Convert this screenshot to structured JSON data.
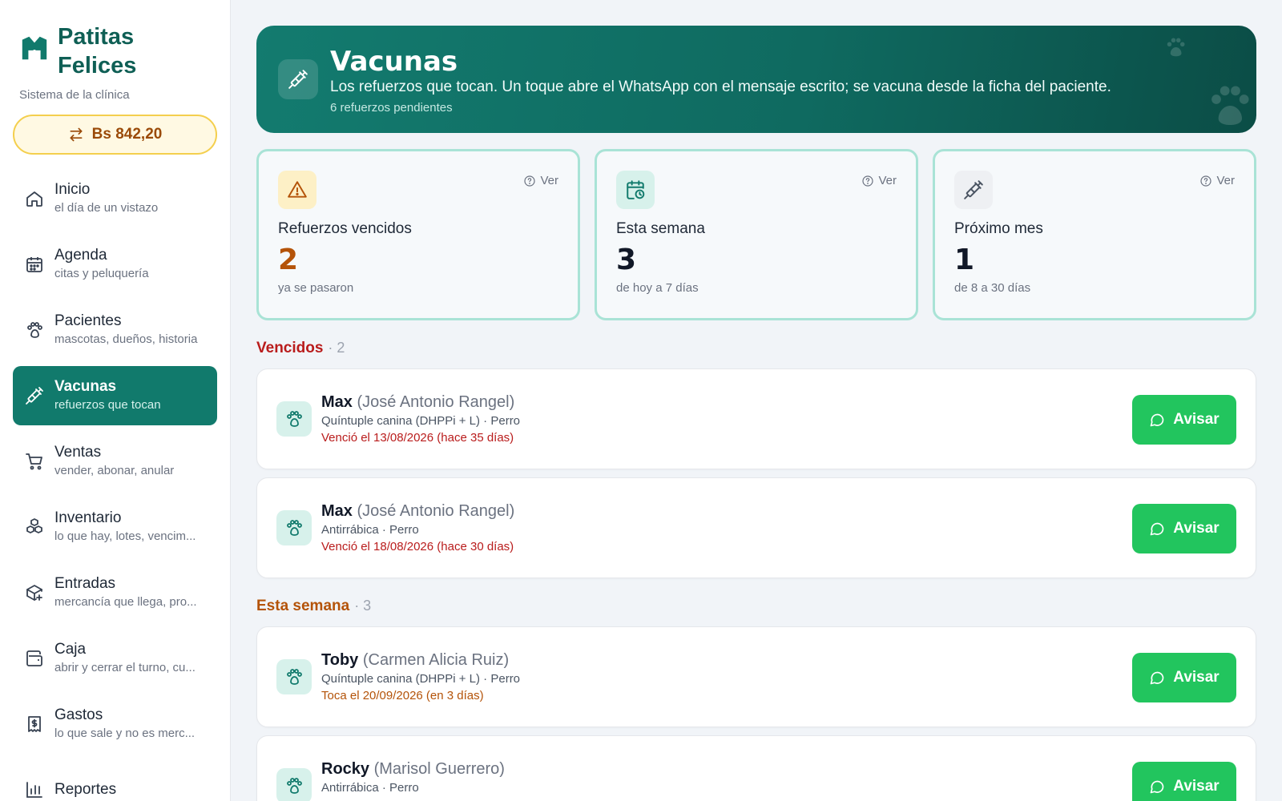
{
  "colors": {
    "brand": "#0f5f55",
    "active_nav": "#117a6c",
    "accent_green": "#22c55e",
    "overdue_red": "#b91c1c",
    "week_orange": "#b45309",
    "card_border": "#a9e3d6"
  },
  "brand": {
    "name_line1": "Patitas",
    "name_line2": "Felices",
    "subtitle": "Sistema de la clínica",
    "icon": "paw-shield-icon"
  },
  "rate": {
    "label": "Bs 842,20",
    "icon": "swap-arrows-icon"
  },
  "nav": {
    "items": [
      {
        "label": "Inicio",
        "sub": "el día de un vistazo",
        "icon": "home-icon"
      },
      {
        "label": "Agenda",
        "sub": "citas y peluquería",
        "icon": "calendar-icon"
      },
      {
        "label": "Pacientes",
        "sub": "mascotas, dueños, historia",
        "icon": "paw-icon"
      },
      {
        "label": "Vacunas",
        "sub": "refuerzos que tocan",
        "icon": "syringe-icon",
        "active": true
      },
      {
        "label": "Ventas",
        "sub": "vender, abonar, anular",
        "icon": "cart-icon"
      },
      {
        "label": "Inventario",
        "sub": "lo que hay, lotes, vencim...",
        "icon": "boxes-icon"
      },
      {
        "label": "Entradas",
        "sub": "mercancía que llega, pro...",
        "icon": "package-plus-icon"
      },
      {
        "label": "Caja",
        "sub": "abrir y cerrar el turno, cu...",
        "icon": "wallet-icon"
      },
      {
        "label": "Gastos",
        "sub": "lo que sale y no es merc...",
        "icon": "receipt-icon"
      },
      {
        "label": "Reportes",
        "sub": "",
        "icon": "bar-chart-icon"
      }
    ]
  },
  "hero": {
    "title": "Vacunas",
    "description": "Los refuerzos que tocan. Un toque abre el WhatsApp con el mensaje escrito; se vacuna desde la ficha del paciente.",
    "count": "6 refuerzos pendientes",
    "icon": "syringe-icon"
  },
  "stats": [
    {
      "label": "Refuerzos vencidos",
      "value": "2",
      "sub": "ya se pasaron",
      "ver": "Ver",
      "icon": "warning-icon",
      "value_color": "#b45309",
      "icon_bg": "#fdf0c6",
      "icon_color": "#b45309"
    },
    {
      "label": "Esta semana",
      "value": "3",
      "sub": "de hoy a 7 días",
      "ver": "Ver",
      "icon": "calendar-clock-icon",
      "value_color": "#111827",
      "icon_bg": "#d7f1eb",
      "icon_color": "#117a6c"
    },
    {
      "label": "Próximo mes",
      "value": "1",
      "sub": "de 8 a 30 días",
      "ver": "Ver",
      "icon": "syringe-icon",
      "value_color": "#111827",
      "icon_bg": "#eef0f3",
      "icon_color": "#4b5563"
    }
  ],
  "sections": {
    "overdue": {
      "title": "Vencidos",
      "count": "· 2"
    },
    "week": {
      "title": "Esta semana",
      "count": "· 3"
    }
  },
  "reminders": [
    {
      "pet": "Max",
      "owner": "(José Antonio Rangel)",
      "vaccine": "Quíntuple canina (DHPPi + L) · Perro",
      "when": "Venció el 13/08/2026 (hace 35 días)",
      "button": "Avisar"
    },
    {
      "pet": "Max",
      "owner": "(José Antonio Rangel)",
      "vaccine": "Antirrábica · Perro",
      "when": "Venció el 18/08/2026 (hace 30 días)",
      "button": "Avisar"
    },
    {
      "pet": "Toby",
      "owner": "(Carmen Alicia Ruiz)",
      "vaccine": "Quíntuple canina (DHPPi + L) · Perro",
      "when": "Toca el 20/09/2026 (en 3 días)",
      "button": "Avisar"
    },
    {
      "pet": "Rocky",
      "owner": "(Marisol Guerrero)",
      "vaccine": "Antirrábica · Perro",
      "when": "",
      "button": "Avisar"
    }
  ]
}
